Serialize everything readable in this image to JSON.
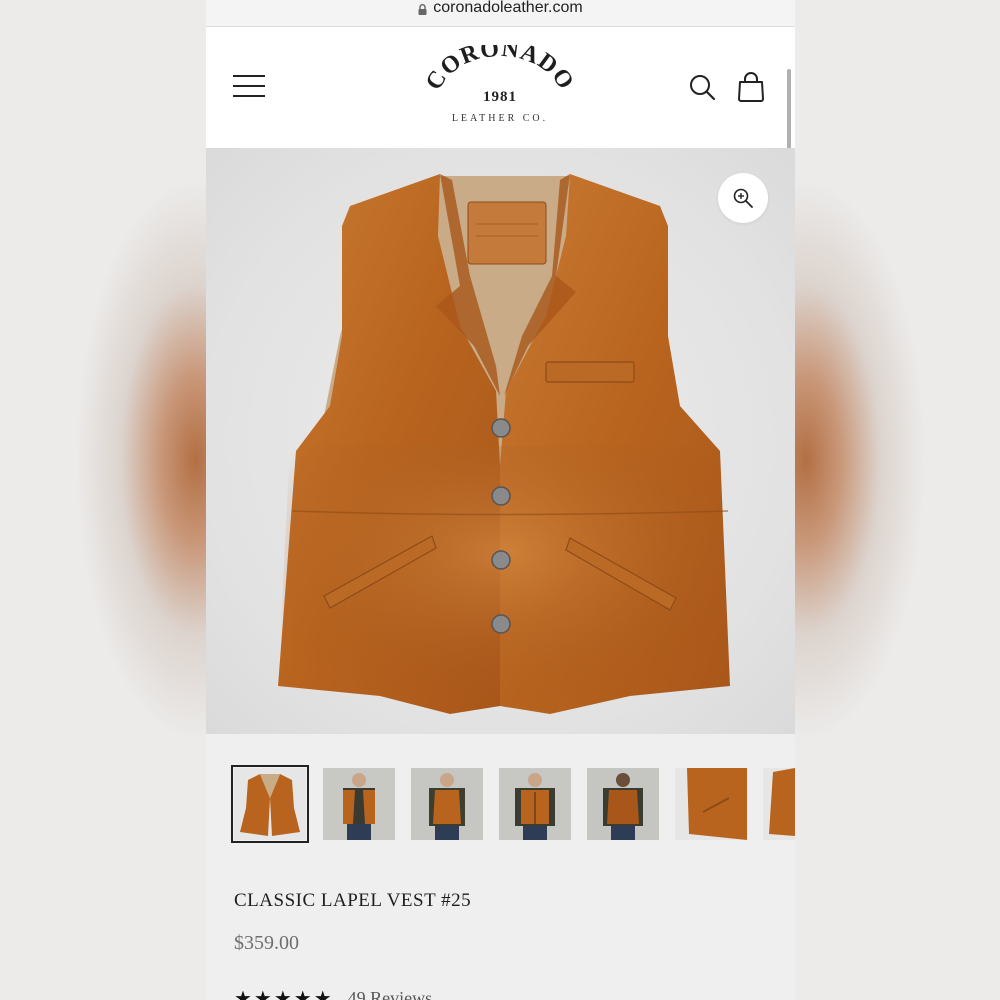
{
  "browser": {
    "url": "coronadoleather.com"
  },
  "header": {
    "logo": {
      "brand": "CORONADO",
      "year": "1981",
      "sub": "LEATHER CO."
    }
  },
  "product": {
    "title": "CLASSIC LAPEL VEST #25",
    "price": "$359.00",
    "rating_stars": "★★★★★",
    "reviews_text": "49 Reviews"
  },
  "icons": {
    "menu": "hamburger-icon",
    "search": "search-icon",
    "cart": "shopping-bag-icon",
    "zoom": "zoom-in-icon",
    "lock": "lock-icon"
  },
  "colors": {
    "leather": "#b8641f",
    "lining": "#c9ab87",
    "page_bg": "#efefef",
    "header_bg": "#ffffff",
    "text": "#1e1e1e",
    "price": "#6f6f6f"
  },
  "thumbnails": [
    "vest-front",
    "model-front-open",
    "model-side",
    "model-front-pockets",
    "model-back",
    "vest-detail-pocket",
    "vest-detail-side"
  ]
}
